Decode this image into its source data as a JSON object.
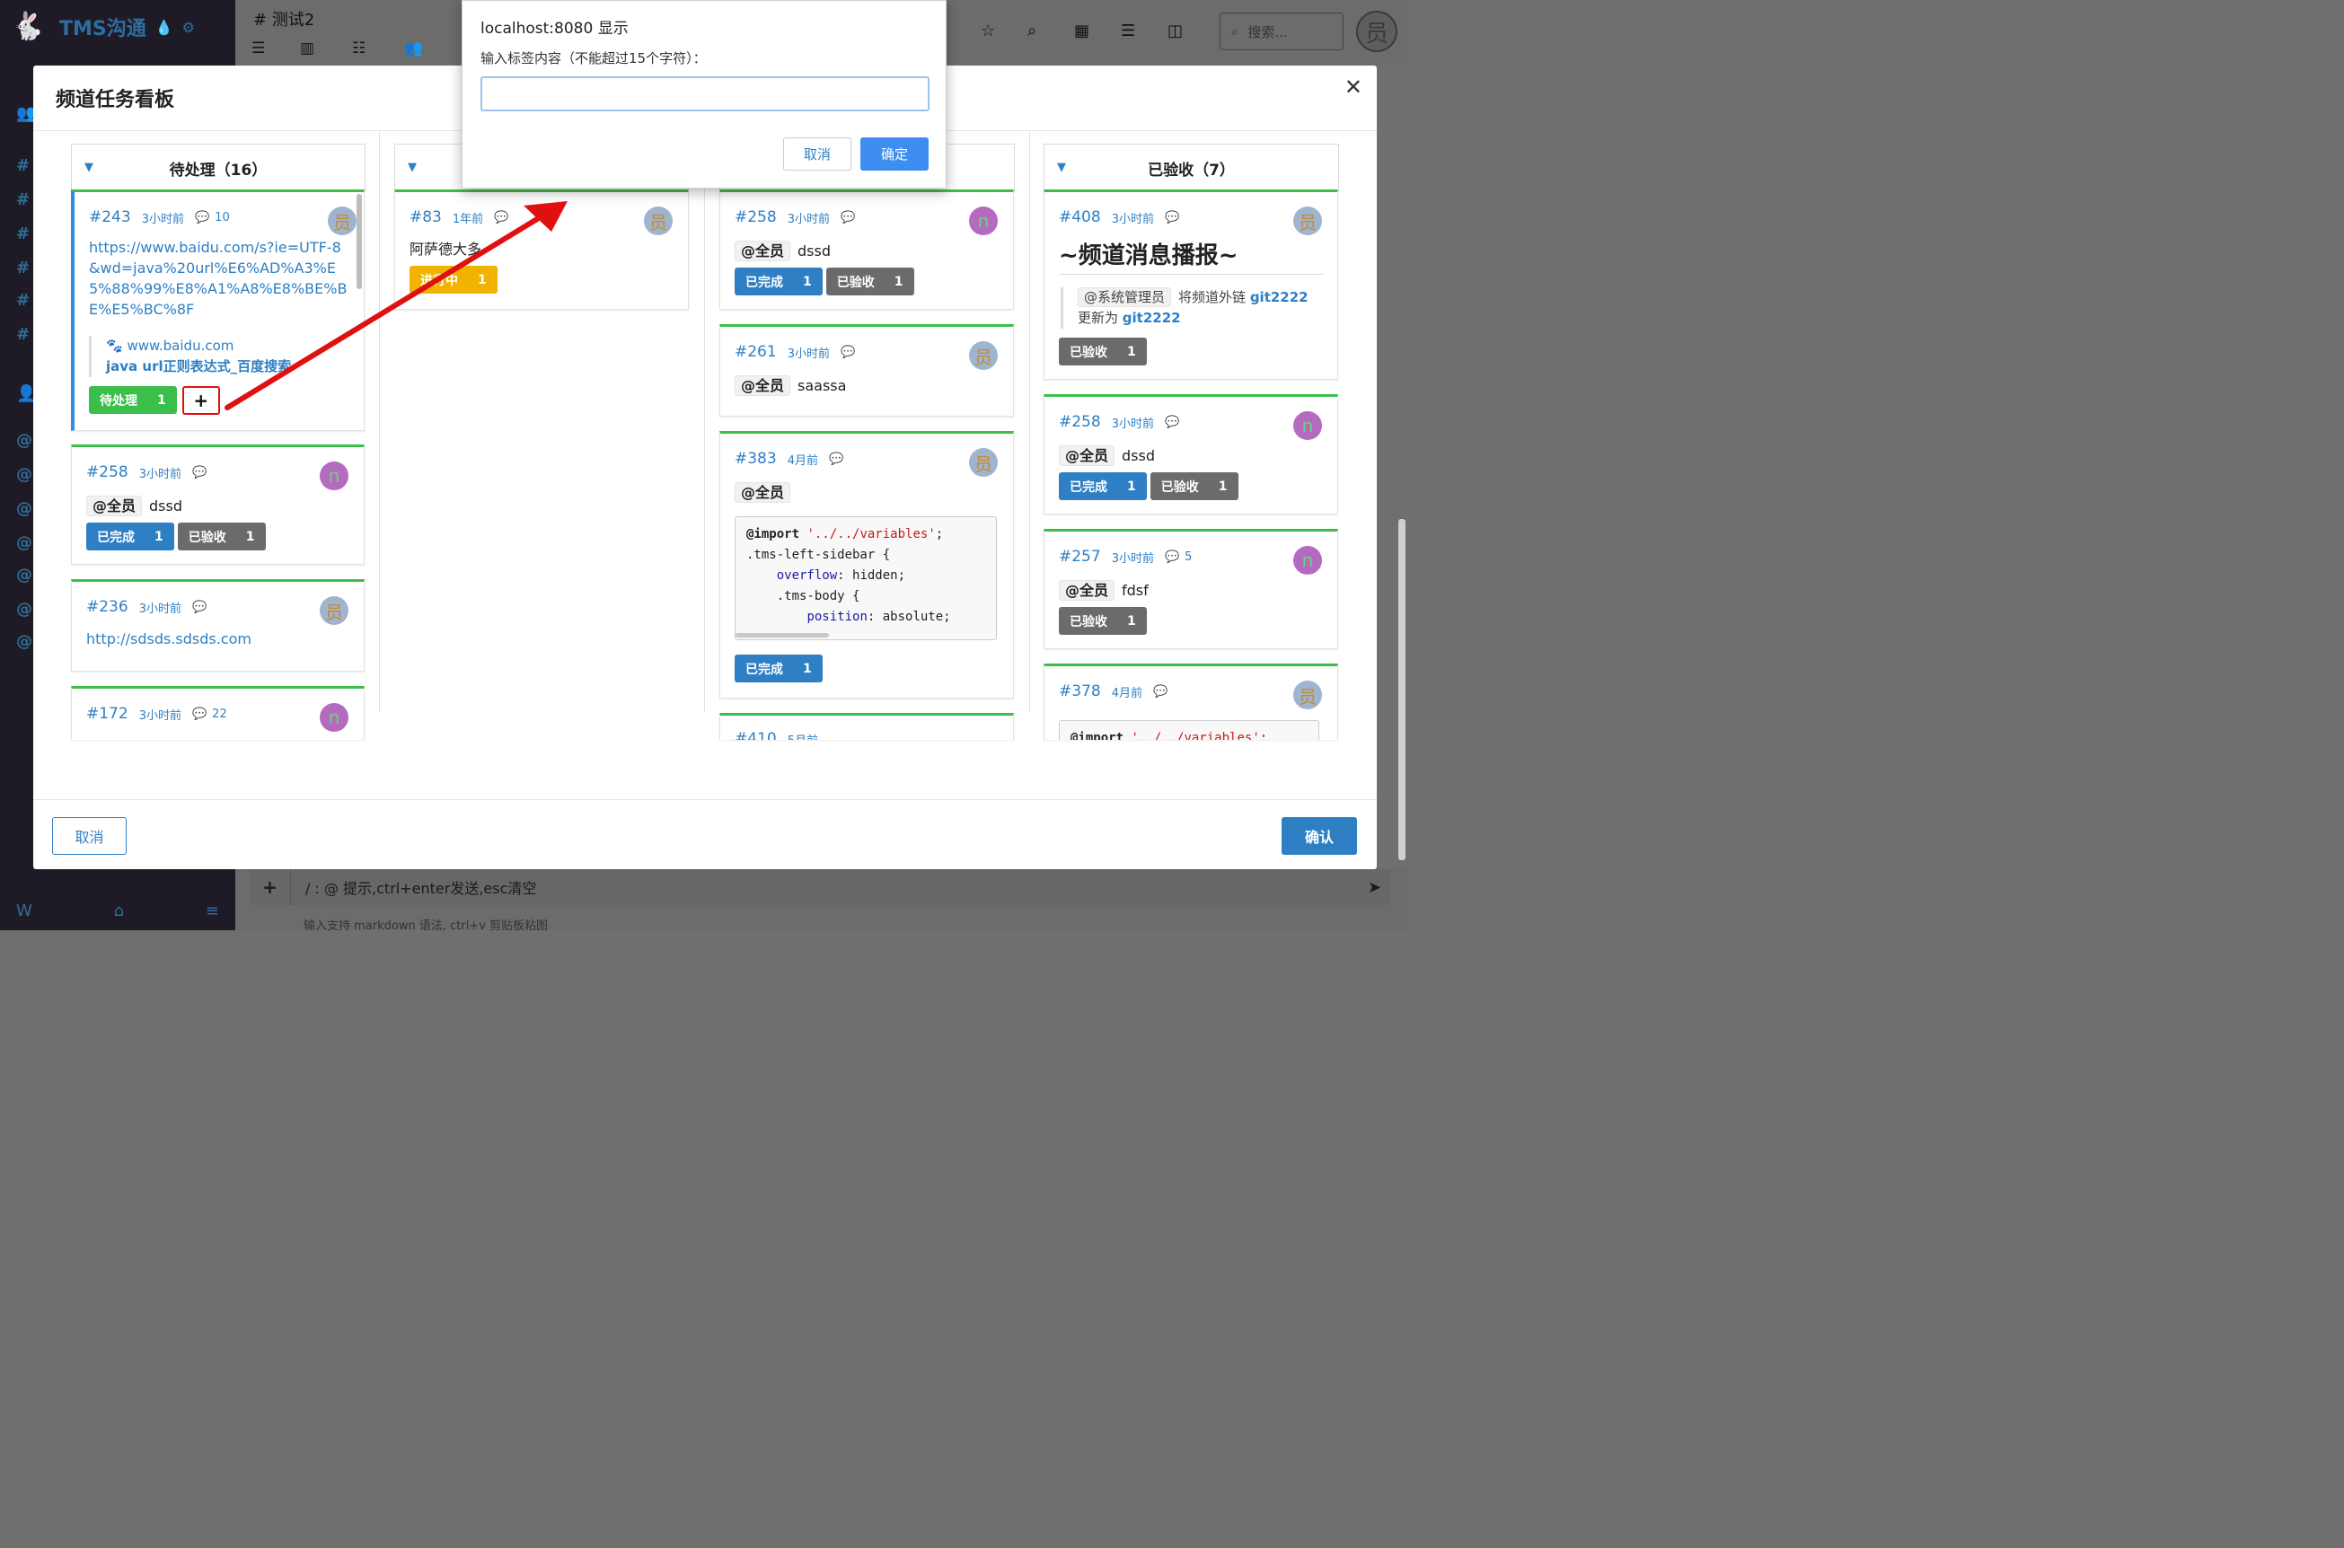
{
  "app": {
    "name": "TMS沟通"
  },
  "channel": {
    "title": "# 测试2"
  },
  "search": {
    "placeholder": "搜索..."
  },
  "composer": {
    "placeholder": "/ : @ 提示,ctrl+enter发送,esc清空",
    "hint": "输入支持 markdown 语法, ctrl+v 剪贴板粘图"
  },
  "avatar_text": "员",
  "modal": {
    "title": "频道任务看板",
    "cancel": "取消",
    "confirm": "确认"
  },
  "alert": {
    "origin": "localhost:8080 显示",
    "prompt": "输入标签内容（不能超过15个字符）：",
    "input_value": "",
    "cancel": "取消",
    "ok": "确定"
  },
  "columns": [
    {
      "title": "待处理（16）",
      "cards": [
        {
          "id": "#243",
          "time": "3小时前",
          "comments": "10",
          "avatar": "员",
          "link": "https://www.baidu.com/s?ie=UTF-8&wd=java%20url%E6%AD%A3%E5%88%99%E8%A1%A8%E8%BE%BE%E5%BC%8F",
          "preview_site": "www.baidu.com",
          "preview_title": "java url正则表达式_百度搜索",
          "tags": [
            {
              "label": "待处理",
              "count": "1"
            }
          ],
          "add_tag": "+"
        },
        {
          "id": "#258",
          "time": "3小时前",
          "comments": "",
          "avatar": "n",
          "mention": "@全员",
          "text": "dssd",
          "tags": [
            {
              "label": "已完成",
              "count": "1"
            },
            {
              "label": "已验收",
              "count": "1"
            }
          ]
        },
        {
          "id": "#236",
          "time": "3小时前",
          "comments": "",
          "avatar": "员",
          "link": "http://sdsds.sdsds.com"
        },
        {
          "id": "#172",
          "time": "3小时前",
          "comments": "22",
          "avatar": "n"
        }
      ]
    },
    {
      "title": "",
      "cards": [
        {
          "id": "#83",
          "time": "1年前",
          "comments": "",
          "avatar": "员",
          "text": "阿萨德大多",
          "tags": [
            {
              "label": "进行中",
              "count": "1"
            }
          ]
        }
      ]
    },
    {
      "title": "",
      "cards": [
        {
          "id": "#258",
          "time": "3小时前",
          "comments": "",
          "avatar": "n",
          "mention": "@全员",
          "text": "dssd",
          "tags": [
            {
              "label": "已完成",
              "count": "1"
            },
            {
              "label": "已验收",
              "count": "1"
            }
          ]
        },
        {
          "id": "#261",
          "time": "3小时前",
          "comments": "",
          "avatar": "员",
          "mention": "@全员",
          "text": "saassa"
        },
        {
          "id": "#383",
          "time": "4月前",
          "comments": "",
          "avatar": "员",
          "mention": "@全员",
          "code": [
            "@import '../../variables';",
            ".tms-left-sidebar {",
            "    overflow: hidden;",
            "    .tms-body {",
            "        position: absolute;"
          ],
          "tags": [
            {
              "label": "已完成",
              "count": "1"
            }
          ]
        },
        {
          "id": "#410",
          "time": "5月前",
          "comments": "",
          "avatar": "员"
        }
      ]
    },
    {
      "title": "已验收（7）",
      "cards": [
        {
          "id": "#408",
          "time": "3小时前",
          "comments": "",
          "avatar": "员",
          "heading": "~频道消息播报~",
          "quote_mention": "@系统管理员",
          "quote_text": "将频道外链",
          "quote_old": "git2222",
          "quote_mid": "更新为",
          "quote_new": "git2222",
          "tags": [
            {
              "label": "已验收",
              "count": "1"
            }
          ]
        },
        {
          "id": "#258",
          "time": "3小时前",
          "comments": "",
          "avatar": "n",
          "mention": "@全员",
          "text": "dssd",
          "tags": [
            {
              "label": "已完成",
              "count": "1"
            },
            {
              "label": "已验收",
              "count": "1"
            }
          ]
        },
        {
          "id": "#257",
          "time": "3小时前",
          "comments": "5",
          "avatar": "n",
          "mention": "@全员",
          "text": "fdsf",
          "tags": [
            {
              "label": "已验收",
              "count": "1"
            }
          ]
        },
        {
          "id": "#378",
          "time": "4月前",
          "comments": "",
          "avatar": "员",
          "code": [
            "@import '../../variables';"
          ]
        }
      ]
    }
  ],
  "colors": {
    "accent": "#2e7fc4",
    "green": "#3bbf4a",
    "annotation": "#e01010"
  }
}
